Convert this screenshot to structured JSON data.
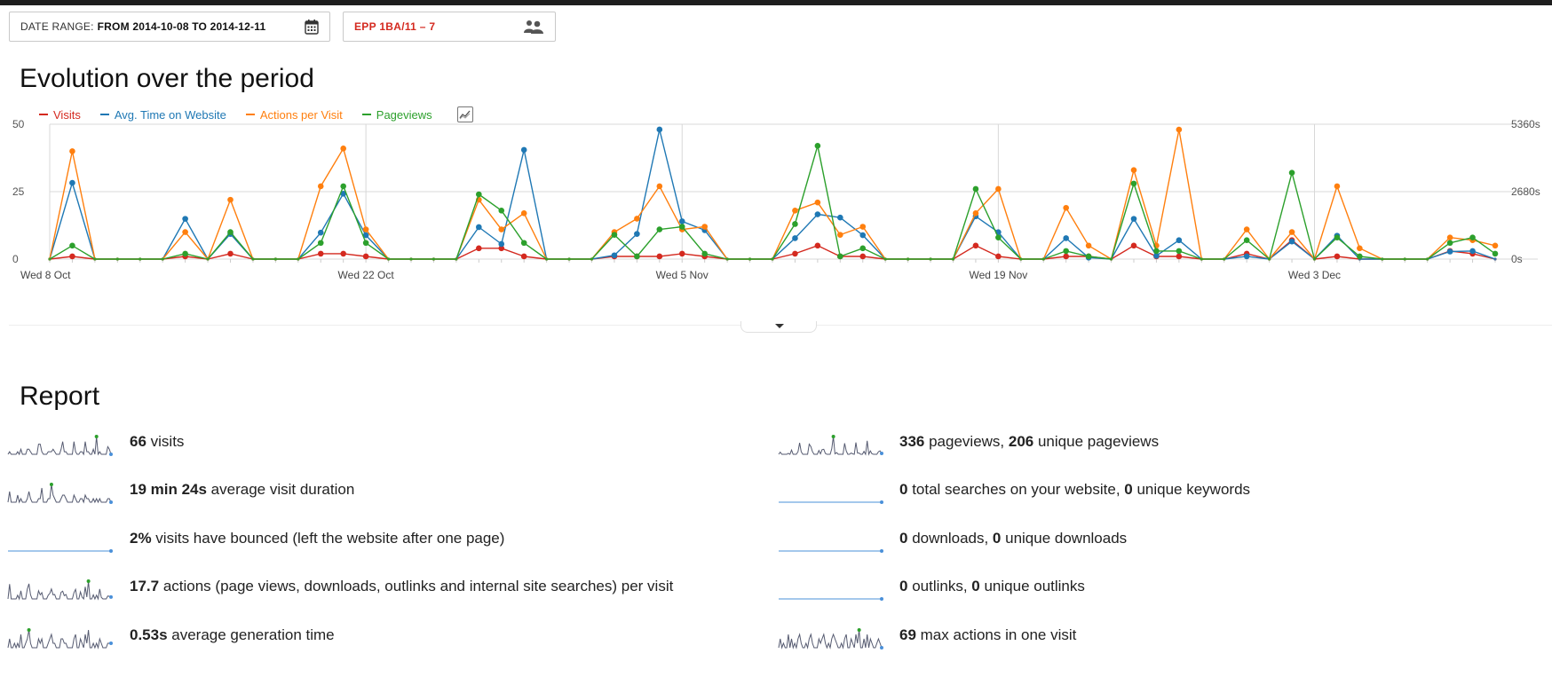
{
  "header": {
    "date_range_label": "DATE RANGE:",
    "date_range_value": "FROM 2014-10-08 TO 2014-12-11",
    "segment_label": "EPP 1BA/11 – 7"
  },
  "evolution": {
    "title": "Evolution over the period",
    "legend": [
      {
        "name": "Visits",
        "color": "#d4291f"
      },
      {
        "name": "Avg. Time on Website",
        "color": "#1f78b4"
      },
      {
        "name": "Actions per Visit",
        "color": "#ff7f0e"
      },
      {
        "name": "Pageviews",
        "color": "#2ca02c"
      }
    ]
  },
  "chart_data": {
    "type": "line",
    "x": [
      "2014-10-08",
      "2014-10-09",
      "2014-10-10",
      "2014-10-11",
      "2014-10-12",
      "2014-10-13",
      "2014-10-14",
      "2014-10-15",
      "2014-10-16",
      "2014-10-17",
      "2014-10-18",
      "2014-10-19",
      "2014-10-20",
      "2014-10-21",
      "2014-10-22",
      "2014-10-23",
      "2014-10-24",
      "2014-10-25",
      "2014-10-26",
      "2014-10-27",
      "2014-10-28",
      "2014-10-29",
      "2014-10-30",
      "2014-10-31",
      "2014-11-01",
      "2014-11-02",
      "2014-11-03",
      "2014-11-04",
      "2014-11-05",
      "2014-11-06",
      "2014-11-07",
      "2014-11-08",
      "2014-11-09",
      "2014-11-10",
      "2014-11-11",
      "2014-11-12",
      "2014-11-13",
      "2014-11-14",
      "2014-11-15",
      "2014-11-16",
      "2014-11-17",
      "2014-11-18",
      "2014-11-19",
      "2014-11-20",
      "2014-11-21",
      "2014-11-22",
      "2014-11-23",
      "2014-11-24",
      "2014-11-25",
      "2014-11-26",
      "2014-11-27",
      "2014-11-28",
      "2014-11-29",
      "2014-11-30",
      "2014-12-01",
      "2014-12-02",
      "2014-12-03",
      "2014-12-04",
      "2014-12-05",
      "2014-12-06",
      "2014-12-07",
      "2014-12-08",
      "2014-12-09",
      "2014-12-10",
      "2014-12-11"
    ],
    "x_tick_labels": [
      "Wed 8 Oct",
      "Wed 22 Oct",
      "Wed 5 Nov",
      "Wed 19 Nov",
      "Wed 3 Dec"
    ],
    "y_left_ticks": [
      "0",
      "25",
      "50"
    ],
    "y_right_ticks": [
      "0s",
      "2680s",
      "5360s"
    ],
    "ylim_left": [
      0,
      50
    ],
    "ylim_right": [
      0,
      5360
    ],
    "grid": true,
    "legend_position": "top-left",
    "series": [
      {
        "name": "Visits",
        "color": "#d4291f",
        "axis": "left",
        "values": [
          0,
          1,
          0,
          0,
          0,
          0,
          1,
          0,
          2,
          0,
          0,
          0,
          2,
          2,
          1,
          0,
          0,
          0,
          0,
          4,
          4,
          1,
          0,
          0,
          0,
          1,
          1,
          1,
          2,
          1,
          0,
          0,
          0,
          2,
          5,
          1,
          1,
          0,
          0,
          0,
          0,
          5,
          1,
          0,
          0,
          1,
          1,
          0,
          5,
          1,
          1,
          0,
          0,
          2,
          0,
          7,
          0,
          1,
          0,
          0,
          0,
          0,
          3,
          2,
          0
        ]
      },
      {
        "name": "Avg. Time on Website",
        "color": "#1f78b4",
        "axis": "right",
        "values": [
          0,
          3030,
          0,
          0,
          0,
          0,
          1600,
          0,
          1000,
          0,
          0,
          0,
          1050,
          2600,
          950,
          0,
          0,
          0,
          0,
          1270,
          600,
          4340,
          0,
          0,
          0,
          150,
          1000,
          5150,
          1500,
          1150,
          0,
          0,
          0,
          830,
          1780,
          1650,
          950,
          0,
          0,
          0,
          0,
          1700,
          1070,
          0,
          0,
          830,
          60,
          0,
          1600,
          130,
          750,
          0,
          0,
          110,
          0,
          700,
          0,
          930,
          0,
          0,
          0,
          0,
          300,
          320,
          0
        ]
      },
      {
        "name": "Actions per Visit",
        "color": "#ff7f0e",
        "axis": "left",
        "values": [
          0,
          40,
          0,
          0,
          0,
          0,
          10,
          0,
          22,
          0,
          0,
          0,
          27,
          41,
          11,
          0,
          0,
          0,
          0,
          22,
          11,
          17,
          0,
          0,
          0,
          10,
          15,
          27,
          11,
          12,
          0,
          0,
          0,
          18,
          21,
          9,
          12,
          0,
          0,
          0,
          0,
          17,
          26,
          0,
          0,
          19,
          5,
          0,
          33,
          5,
          48,
          0,
          0,
          11,
          0,
          10,
          0,
          27,
          4,
          0,
          0,
          0,
          8,
          7,
          5
        ]
      },
      {
        "name": "Pageviews",
        "color": "#2ca02c",
        "axis": "left",
        "values": [
          0,
          5,
          0,
          0,
          0,
          0,
          2,
          0,
          10,
          0,
          0,
          0,
          6,
          27,
          6,
          0,
          0,
          0,
          0,
          24,
          18,
          6,
          0,
          0,
          0,
          9,
          1,
          11,
          12,
          2,
          0,
          0,
          0,
          13,
          42,
          1,
          4,
          0,
          0,
          0,
          0,
          26,
          8,
          0,
          0,
          3,
          1,
          0,
          28,
          3,
          3,
          0,
          0,
          7,
          0,
          32,
          0,
          8,
          1,
          0,
          0,
          0,
          6,
          8,
          2
        ]
      }
    ]
  },
  "report": {
    "title": "Report",
    "left": [
      {
        "parts": [
          {
            "b": "66"
          },
          {
            "t": " visits"
          }
        ]
      },
      {
        "parts": [
          {
            "b": "19 min 24s"
          },
          {
            "t": " average visit duration"
          }
        ]
      },
      {
        "parts": [
          {
            "b": "2%"
          },
          {
            "t": " visits have bounced (left the website after one page)"
          }
        ]
      },
      {
        "parts": [
          {
            "b": "17.7"
          },
          {
            "t": " actions (page views, downloads, outlinks and internal site searches) per visit"
          }
        ]
      },
      {
        "parts": [
          {
            "b": "0.53s"
          },
          {
            "t": " average generation time"
          }
        ]
      }
    ],
    "right": [
      {
        "parts": [
          {
            "b": "336"
          },
          {
            "t": " pageviews, "
          },
          {
            "b": "206"
          },
          {
            "t": " unique pageviews"
          }
        ]
      },
      {
        "parts": [
          {
            "b": "0"
          },
          {
            "t": " total searches on your website, "
          },
          {
            "b": "0"
          },
          {
            "t": " unique keywords"
          }
        ]
      },
      {
        "parts": [
          {
            "b": "0"
          },
          {
            "t": " downloads, "
          },
          {
            "b": "0"
          },
          {
            "t": " unique downloads"
          }
        ]
      },
      {
        "parts": [
          {
            "b": "0"
          },
          {
            "t": " outlinks, "
          },
          {
            "b": "0"
          },
          {
            "t": " unique outlinks"
          }
        ]
      },
      {
        "parts": [
          {
            "b": "69"
          },
          {
            "t": " max actions in one visit"
          }
        ]
      }
    ]
  },
  "sparklines": {
    "visits": [
      0,
      1,
      0,
      0,
      0,
      0,
      1,
      0,
      2,
      0,
      0,
      0,
      2,
      2,
      1,
      0,
      0,
      0,
      0,
      4,
      4,
      1,
      0,
      0,
      0,
      1,
      1,
      1,
      2,
      1,
      0,
      0,
      0,
      2,
      5,
      1,
      1,
      0,
      0,
      0,
      0,
      5,
      1,
      0,
      0,
      1,
      1,
      0,
      5,
      1,
      1,
      0,
      0,
      2,
      0,
      7,
      0,
      1,
      0,
      0,
      0,
      0,
      3,
      2,
      0
    ],
    "duration": [
      0,
      3,
      0,
      0,
      0,
      0,
      2,
      0,
      1,
      0,
      0,
      0,
      1,
      3,
      1,
      0,
      0,
      0,
      0,
      1,
      1,
      4,
      0,
      0,
      0,
      1,
      1,
      5,
      2,
      1,
      0,
      0,
      0,
      1,
      2,
      2,
      1,
      0,
      0,
      0,
      0,
      2,
      1,
      0,
      0,
      1,
      1,
      0,
      2,
      1,
      1,
      0,
      0,
      1,
      0,
      1,
      0,
      1,
      0,
      0,
      0,
      0,
      1,
      1,
      0
    ],
    "bounce": [
      0,
      0,
      0,
      0,
      0,
      0,
      0,
      0,
      0,
      0,
      0,
      0,
      0,
      0,
      0,
      0,
      0,
      0,
      0,
      0,
      0,
      0,
      0,
      0,
      0,
      0,
      0,
      0,
      0,
      0,
      0,
      0,
      0,
      0,
      0,
      0,
      0,
      0,
      0,
      0,
      0,
      0,
      0,
      0,
      0,
      0,
      0,
      0,
      0,
      0,
      0,
      0,
      0,
      0,
      0,
      0,
      0,
      0,
      0,
      0,
      0,
      0,
      0,
      0,
      0
    ],
    "actions": [
      0,
      40,
      0,
      0,
      0,
      0,
      10,
      0,
      22,
      0,
      0,
      0,
      27,
      41,
      11,
      0,
      0,
      0,
      0,
      22,
      11,
      17,
      0,
      0,
      0,
      10,
      15,
      27,
      11,
      12,
      0,
      0,
      0,
      18,
      21,
      9,
      12,
      0,
      0,
      0,
      0,
      17,
      26,
      0,
      0,
      19,
      5,
      0,
      33,
      5,
      48,
      0,
      0,
      11,
      0,
      10,
      0,
      27,
      4,
      0,
      0,
      0,
      8,
      7,
      5
    ],
    "gentime": [
      0,
      2,
      0,
      0,
      1,
      0,
      1,
      0,
      3,
      0,
      0,
      1,
      2,
      4,
      1,
      0,
      0,
      0,
      0,
      2,
      1,
      2,
      0,
      0,
      0,
      1,
      2,
      3,
      1,
      1,
      0,
      0,
      0,
      2,
      2,
      1,
      1,
      0,
      0,
      0,
      0,
      2,
      3,
      0,
      0,
      2,
      1,
      0,
      3,
      1,
      4,
      0,
      0,
      1,
      0,
      1,
      0,
      2,
      1,
      0,
      0,
      0,
      1,
      1,
      1
    ],
    "pageviews": [
      0,
      5,
      0,
      0,
      0,
      0,
      2,
      0,
      10,
      0,
      0,
      0,
      6,
      27,
      6,
      0,
      0,
      0,
      0,
      24,
      18,
      6,
      0,
      0,
      0,
      9,
      1,
      11,
      12,
      2,
      0,
      0,
      0,
      13,
      42,
      1,
      4,
      0,
      0,
      0,
      0,
      26,
      8,
      0,
      0,
      3,
      1,
      0,
      28,
      3,
      3,
      0,
      0,
      7,
      0,
      32,
      0,
      8,
      1,
      0,
      0,
      0,
      6,
      8,
      2
    ],
    "zero": [
      0,
      0,
      0,
      0,
      0,
      0,
      0,
      0,
      0,
      0,
      0,
      0,
      0,
      0,
      0,
      0,
      0,
      0,
      0,
      0,
      0,
      0,
      0,
      0,
      0,
      0,
      0,
      0,
      0,
      0,
      0,
      0,
      0,
      0,
      0,
      0,
      0,
      0,
      0,
      0,
      0,
      0,
      0,
      0,
      0,
      0,
      0,
      0,
      0,
      0,
      0,
      0,
      0,
      0,
      0,
      0,
      0,
      0,
      0,
      0,
      0,
      0,
      0,
      0,
      0
    ],
    "maxactions": [
      0,
      2,
      0,
      1,
      0,
      0,
      3,
      0,
      2,
      0,
      1,
      0,
      2,
      3,
      1,
      0,
      0,
      1,
      0,
      2,
      3,
      1,
      0,
      0,
      0,
      2,
      1,
      2,
      3,
      1,
      0,
      1,
      0,
      2,
      3,
      2,
      1,
      0,
      0,
      1,
      0,
      2,
      3,
      0,
      0,
      2,
      1,
      0,
      3,
      1,
      4,
      0,
      0,
      2,
      0,
      3,
      0,
      2,
      1,
      0,
      0,
      1,
      2,
      1,
      0
    ]
  }
}
